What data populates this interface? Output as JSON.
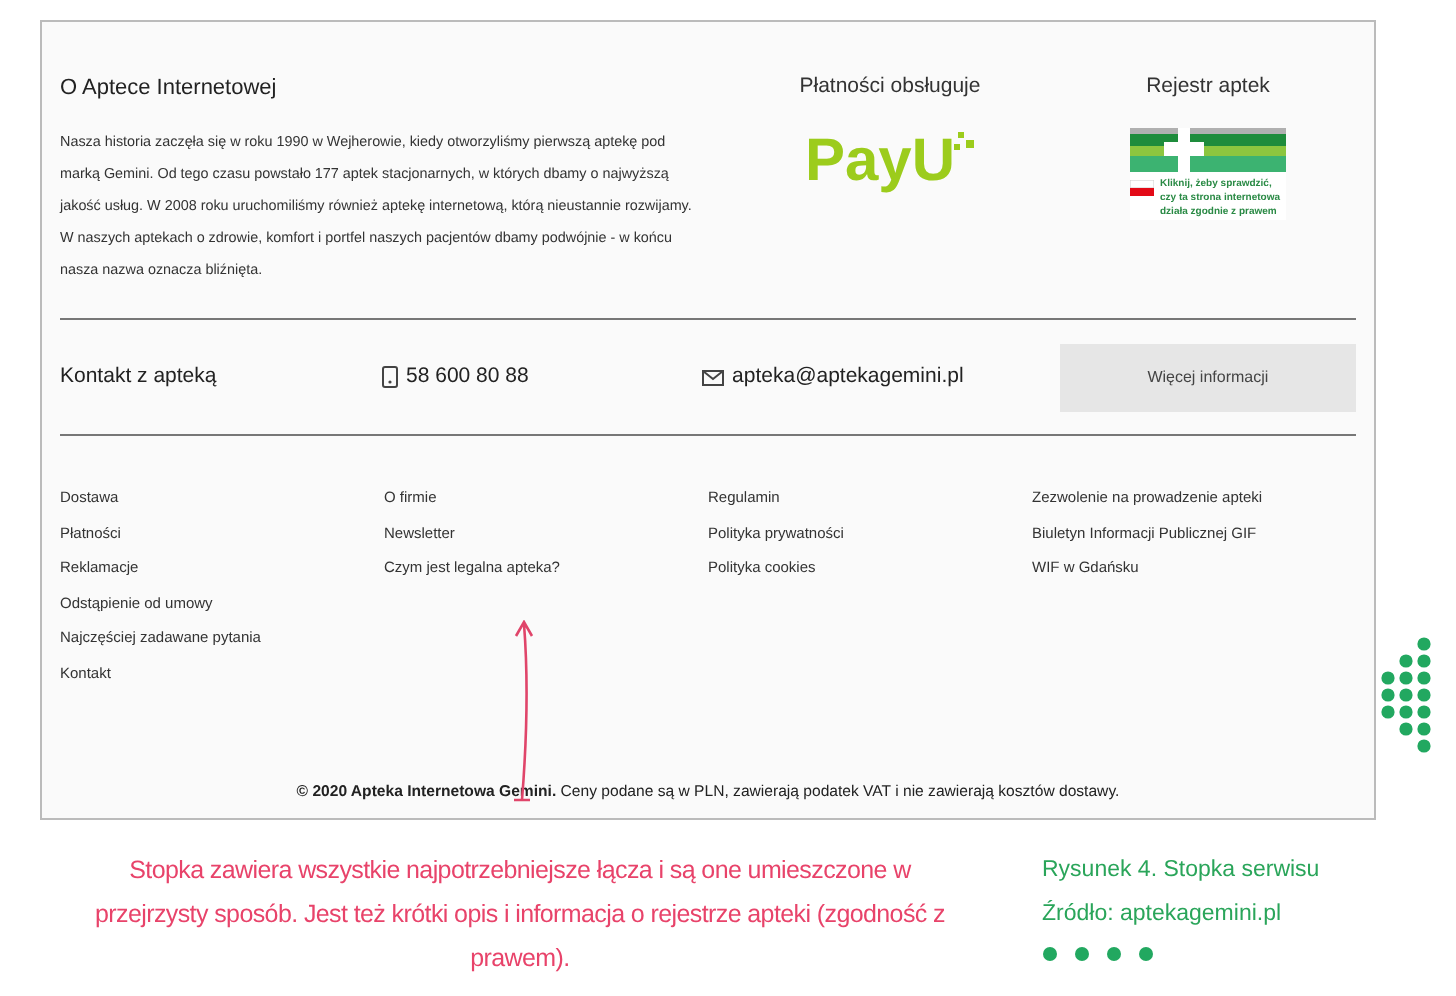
{
  "about": {
    "title": "O Aptece Internetowej",
    "text": "Nasza historia zaczęła się w roku 1990 w Wejherowie, kiedy otworzyliśmy pierwszą aptekę pod marką Gemini. Od tego czasu powstało 177 aptek stacjonarnych, w których dbamy o najwyższą jakość usług. W 2008 roku uruchomiliśmy również aptekę internetową, którą nieustannie rozwijamy. W naszych aptekach o zdrowie, komfort i portfel naszych pacjentów dbamy podwójnie - w końcu nasza nazwa oznacza bliźnięta."
  },
  "payments": {
    "title": "Płatności obsługuje",
    "logo": "PayU"
  },
  "register": {
    "title": "Rejestr aptek",
    "badge_text": "Kliknij, żeby sprawdzić, czy ta strona internetowa działa zgodnie z prawem"
  },
  "contact": {
    "title": "Kontakt z apteką",
    "phone": "58 600 80 88",
    "email": "apteka@aptekagemini.pl",
    "button": "Więcej informacji"
  },
  "link_columns": [
    [
      "Dostawa",
      "Płatności",
      "Reklamacje",
      "Odstąpienie od umowy",
      "Najczęściej zadawane pytania",
      "Kontakt"
    ],
    [
      "O firmie",
      "Newsletter",
      "Czym jest legalna apteka?"
    ],
    [
      "Regulamin",
      "Polityka prywatności",
      "Polityka cookies"
    ],
    [
      "Zezwolenie na prowadzenie apteki",
      "Biuletyn Informacji Publicznej GIF",
      "WIF w Gdańsku"
    ]
  ],
  "copyright": "**© 2020 Apteka Internetowa Gemini.** Ceny podane są w PLN, zawierają podatek VAT i nie zawierają kosztów dostawy.",
  "annotation": "Stopka zawiera wszystkie najpotrzebniejsze łącza i są one umieszczone w przejrzysty sposób. Jest też krótki opis i informacja o rejestrze apteki (zgodność z prawem).",
  "caption": [
    "Rysunek 4. Stopka serwisu",
    "Źródło: aptekagemini.pl"
  ]
}
